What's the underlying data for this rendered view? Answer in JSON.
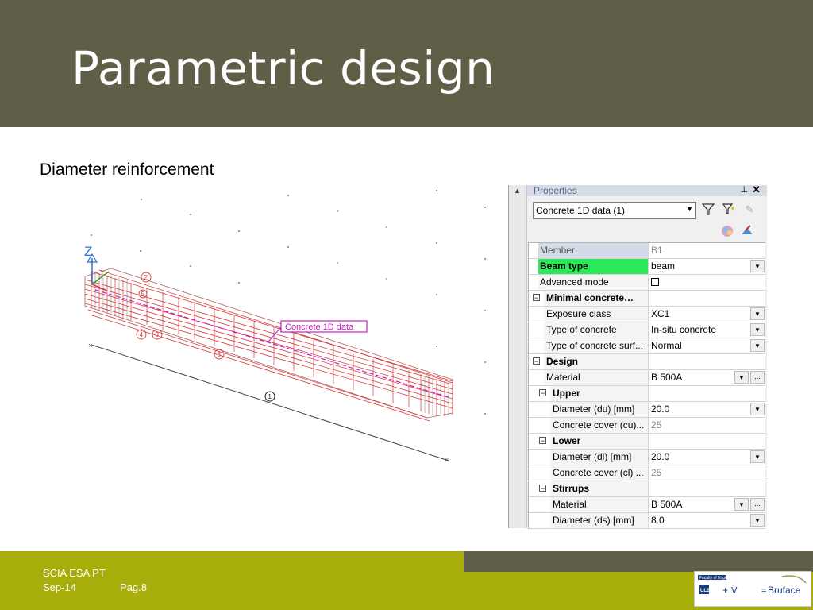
{
  "slide": {
    "title": "Parametric design",
    "subtitle": "Diameter reinforcement"
  },
  "cad": {
    "axis_label": "Z",
    "callout_label": "Concrete 1D data",
    "node_labels": [
      "1",
      "2",
      "3",
      "4",
      "5",
      "6"
    ]
  },
  "properties_panel": {
    "title": "Properties",
    "selector_value": "Concrete 1D data (1)",
    "rows": [
      {
        "label": "Member",
        "value": "B1"
      },
      {
        "label": "Beam type",
        "value": "beam"
      },
      {
        "label": "Advanced mode",
        "value": ""
      },
      {
        "label": "Minimal concrete…",
        "value": ""
      },
      {
        "label": "Exposure class",
        "value": "XC1"
      },
      {
        "label": "Type of concrete",
        "value": "In-situ concrete"
      },
      {
        "label": "Type of concrete surf...",
        "value": "Normal"
      },
      {
        "label": "Design",
        "value": ""
      },
      {
        "label": "Material",
        "value": "B 500A"
      },
      {
        "label": "Upper",
        "value": ""
      },
      {
        "label": "Diameter (du) [mm]",
        "value": "20.0"
      },
      {
        "label": "Concrete cover (cu)...",
        "value": "25"
      },
      {
        "label": "Lower",
        "value": ""
      },
      {
        "label": "Diameter (dl) [mm]",
        "value": "20.0"
      },
      {
        "label": "Concrete cover (cl) ...",
        "value": "25"
      },
      {
        "label": "Stirrups",
        "value": ""
      },
      {
        "label": "Material",
        "value": "B 500A"
      },
      {
        "label": "Diameter (ds) [mm]",
        "value": "8.0"
      }
    ]
  },
  "footer": {
    "line1": "SCIA ESA PT",
    "line2": "Sep-14",
    "page": "Pag.8"
  },
  "logo": {
    "faculty_text": "Faculty of Engineering of",
    "ulb": "ULB",
    "brand": "Bruface"
  },
  "colors": {
    "header_bg": "#5f5f48",
    "footer_bg": "#a7ae0b",
    "highlight_row": "#2ee85a",
    "rebar": "#d63a3a",
    "callout": "#c71ac7"
  }
}
